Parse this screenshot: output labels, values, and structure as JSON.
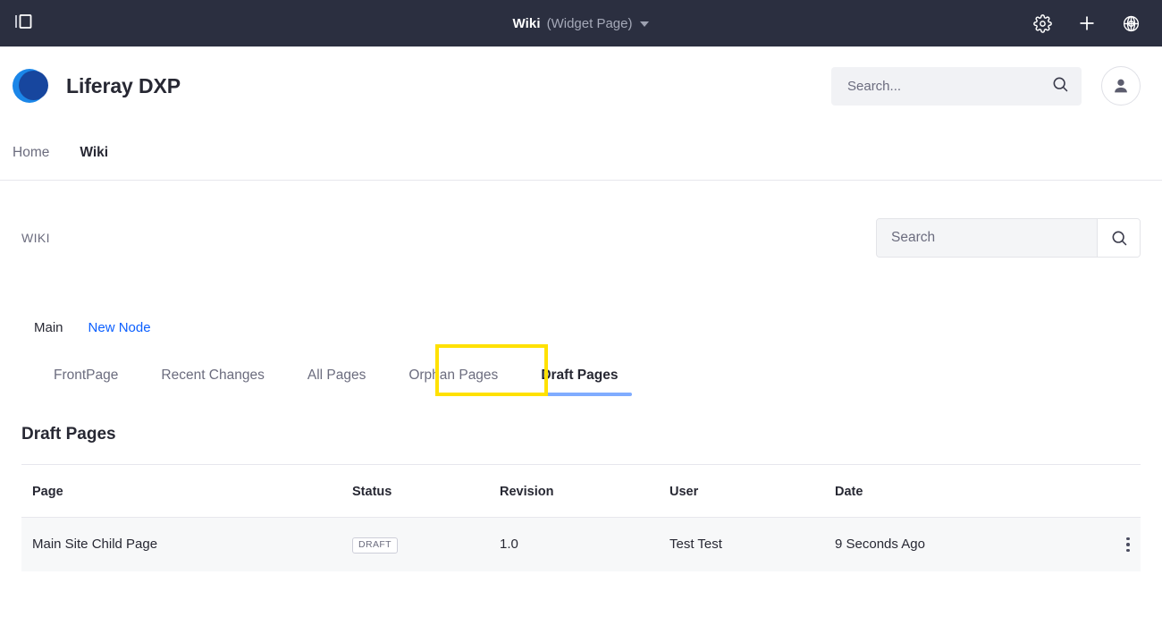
{
  "controlbar": {
    "panel_icon": "sidebar-panel-icon",
    "title": "Wiki",
    "subtitle": "(Widget Page)",
    "dropdown_icon": "caret-down-icon",
    "actions": [
      {
        "name": "gear-icon",
        "label": "Settings"
      },
      {
        "name": "plus-icon",
        "label": "Add"
      },
      {
        "name": "globe-icon",
        "label": "Site"
      }
    ]
  },
  "header": {
    "brand_name": "Liferay DXP",
    "logo_icon": "liferay-logo-icon",
    "search": {
      "value": "",
      "placeholder": "Search...",
      "icon": "search-icon"
    },
    "avatar_icon": "user-avatar-icon"
  },
  "sitenav": {
    "items": [
      {
        "label": "Home",
        "active": false
      },
      {
        "label": "Wiki",
        "active": true
      }
    ]
  },
  "portlet": {
    "label": "WIKI",
    "search": {
      "value": "",
      "placeholder": "Search",
      "button_icon": "search-icon"
    },
    "node_tabs": [
      {
        "label": "Main",
        "style": "current"
      },
      {
        "label": "New Node",
        "style": "link"
      }
    ],
    "page_tabs": [
      {
        "label": "FrontPage",
        "active": false
      },
      {
        "label": "Recent Changes",
        "active": false
      },
      {
        "label": "All Pages",
        "active": false
      },
      {
        "label": "Orphan Pages",
        "active": false
      },
      {
        "label": "Draft Pages",
        "active": true
      }
    ],
    "section_title": "Draft Pages"
  },
  "table": {
    "columns": [
      "Page",
      "Status",
      "Revision",
      "User",
      "Date"
    ],
    "rows": [
      {
        "page": "Main Site Child Page",
        "status": "DRAFT",
        "revision": "1.0",
        "user": "Test Test",
        "date": "9 Seconds Ago",
        "actions_icon": "kebab-menu-icon"
      }
    ]
  },
  "colors": {
    "controlbar_bg": "#2b2f40",
    "accent_link": "#0b5fff",
    "tab_underline": "#80acff",
    "highlight": "#ffe100",
    "row_bg": "#f7f8f9",
    "logo_light": "#1b86e8",
    "logo_dark": "#17469e"
  }
}
